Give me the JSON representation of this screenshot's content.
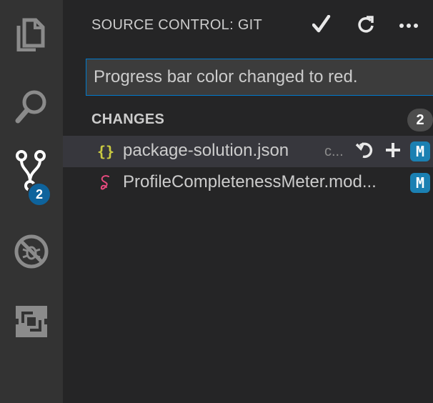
{
  "activity_bar": {
    "items": [
      {
        "name": "explorer-icon"
      },
      {
        "name": "search-icon"
      },
      {
        "name": "source-control-icon"
      },
      {
        "name": "debug-icon"
      },
      {
        "name": "extensions-icon"
      }
    ],
    "source_control_badge": "2"
  },
  "header": {
    "title": "SOURCE CONTROL: GIT",
    "actions": [
      "commit-checkmark-icon",
      "refresh-icon",
      "more-actions-icon"
    ]
  },
  "commit": {
    "message": "Progress bar color changed to red."
  },
  "changes": {
    "label": "CHANGES",
    "count": "2",
    "files": [
      {
        "name": "package-solution.json",
        "path": "c...",
        "icon": "json-braces-icon",
        "status": "M",
        "selected": true
      },
      {
        "name": "ProfileCompletenessMeter.mod...",
        "path": "",
        "icon": "sass-icon",
        "status": "M",
        "selected": false
      }
    ]
  },
  "colors": {
    "activity_bar_bg": "#333333",
    "sidebar_bg": "#252526",
    "accent": "#007acc",
    "badge_blue": "#0e639c",
    "modified_badge": "#1b80b2",
    "selected_row": "#37373d"
  }
}
